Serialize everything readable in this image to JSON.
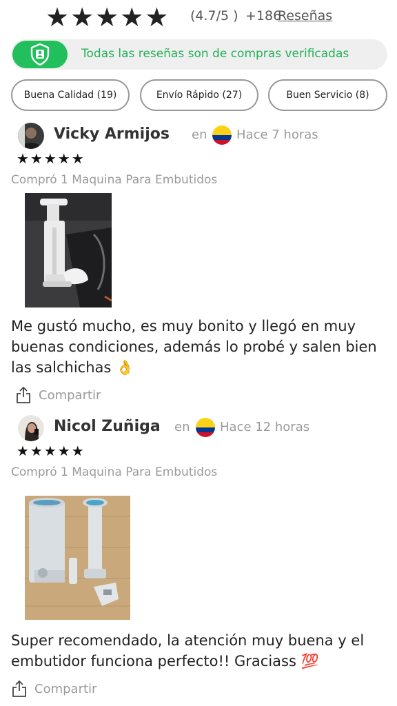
{
  "summary": {
    "stars": [
      "★",
      "★",
      "★",
      "★",
      "★"
    ],
    "rating_text": "(4.7/5 )",
    "count_text": "+186",
    "reviews_link": "Reseñas"
  },
  "verified_banner": {
    "text": "Todas las reseñas son de compras verificadas"
  },
  "filters": [
    {
      "label": "Buena Calidad (19)"
    },
    {
      "label": "Envío Rápido (27)"
    },
    {
      "label": "Buen Servicio (8)"
    }
  ],
  "reviews": [
    {
      "name": "Vicky Armijos",
      "en": "en",
      "time": "Hace 7 horas",
      "stars": "★★★★★",
      "bought": "Compró 1 Maquina Para Embutidos",
      "text": "Me gustó mucho, es muy bonito y llegó en muy buenas condiciones, además lo probé y salen bien las salchichas 👌",
      "share": "Compartir"
    },
    {
      "name": "Nicol Zuñiga",
      "en": "en",
      "time": "Hace 12 horas",
      "stars": "★★★★★",
      "bought": "Compró 1 Maquina Para Embutidos",
      "text": "Super recomendado, la atención muy buena y el embutidor funciona perfecto!! Graciass 💯",
      "share": "Compartir"
    }
  ],
  "colors": {
    "accent_green": "#21c05c",
    "muted": "#9a9a9a"
  }
}
